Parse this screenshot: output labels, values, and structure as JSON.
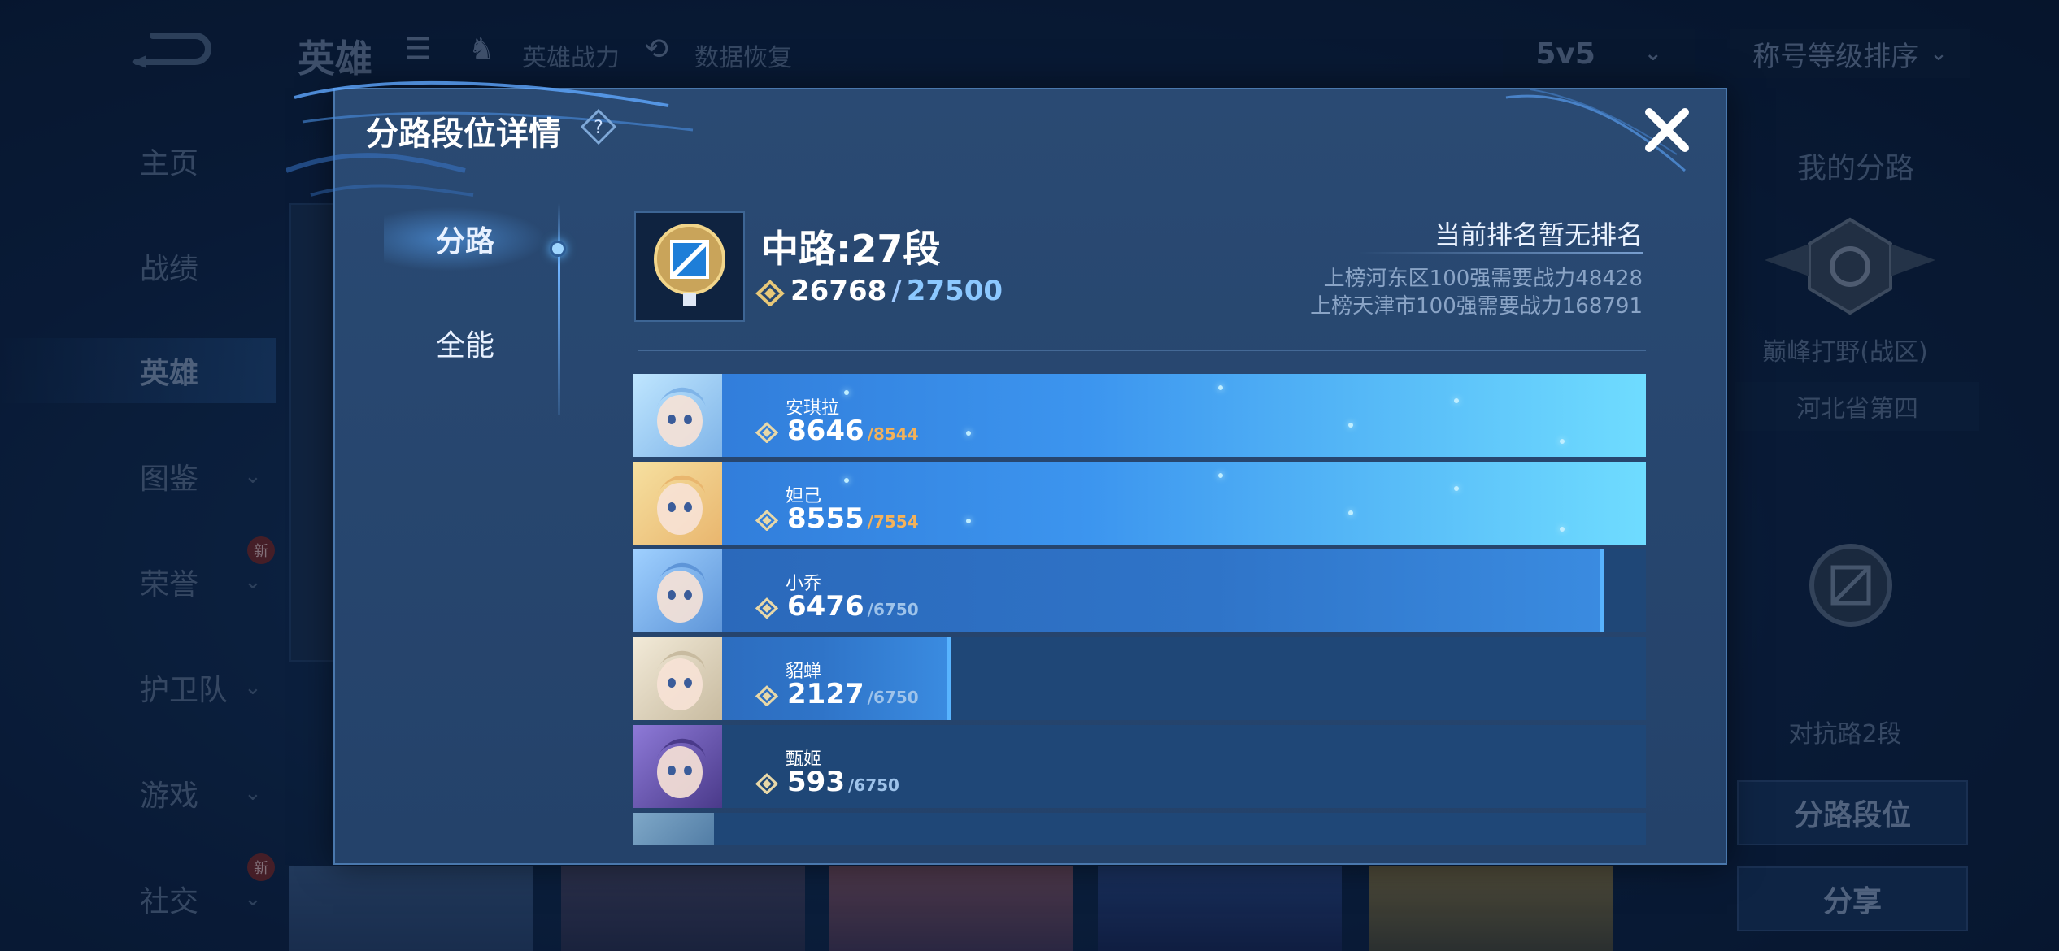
{
  "background": {
    "top_title": "英雄",
    "hero_power_link": "英雄战力",
    "data_restore_link": "数据恢复",
    "mode_select": "5v5",
    "sort_select": "称号等级排序",
    "nav": [
      {
        "label": "主页",
        "chevron": false,
        "badge": ""
      },
      {
        "label": "战绩",
        "chevron": false,
        "badge": ""
      },
      {
        "label": "英雄",
        "chevron": false,
        "badge": "",
        "active": true
      },
      {
        "label": "图鉴",
        "chevron": true,
        "badge": ""
      },
      {
        "label": "荣誉",
        "chevron": true,
        "badge": "新"
      },
      {
        "label": "护卫队",
        "chevron": true,
        "badge": ""
      },
      {
        "label": "游戏",
        "chevron": true,
        "badge": ""
      },
      {
        "label": "社交",
        "chevron": true,
        "badge": "新"
      }
    ],
    "right_panel": {
      "title": "我的分路",
      "peak_label": "巅峰打野(战区)",
      "region_label": "河北省第四",
      "lane_label": "对抗路2段",
      "lane_rank_button": "分路段位",
      "share_button": "分享"
    }
  },
  "modal": {
    "title": "分路段位详情",
    "tabs": [
      {
        "label": "分路",
        "active": true
      },
      {
        "label": "全能",
        "active": false
      }
    ],
    "lane": {
      "title": "中路:27段",
      "power_current": "26768",
      "power_max": "27500"
    },
    "ranking": {
      "status": "当前排名暂无排名",
      "req_1": "上榜河东区100强需要战力48428",
      "req_2": "上榜天津市100强需要战力168791"
    },
    "heroes": [
      {
        "name": "安琪拉",
        "power": "8646",
        "max": "/8544",
        "progress": 1.0,
        "max_color": "#f4b25a"
      },
      {
        "name": "妲己",
        "power": "8555",
        "max": "/7554",
        "progress": 1.0,
        "max_color": "#f4b25a"
      },
      {
        "name": "小乔",
        "power": "6476",
        "max": "/6750",
        "progress": 0.959,
        "max_color": "#9ec3ea"
      },
      {
        "name": "貂蝉",
        "power": "2127",
        "max": "/6750",
        "progress": 0.315,
        "max_color": "#9ec3ea"
      },
      {
        "name": "甄姬",
        "power": "593",
        "max": "/6750",
        "progress": 0.088,
        "max_color": "#9ec3ea"
      }
    ]
  },
  "colors": {
    "accent_blue": "#3a96f0",
    "over_max": "#f4b25a"
  }
}
